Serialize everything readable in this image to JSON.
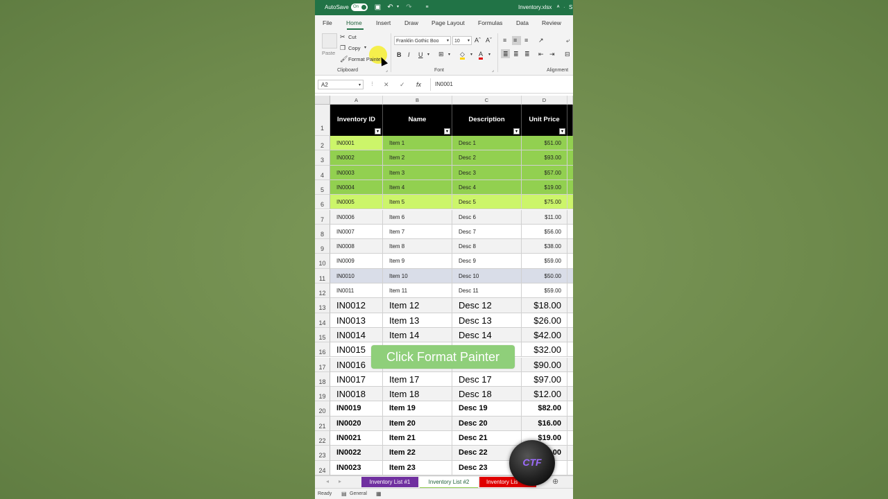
{
  "titlebar": {
    "autosave_label": "AutoSave",
    "autosave_state": "On",
    "file_name": "Inventory.xlsx",
    "trailing": "S"
  },
  "tabs": [
    "File",
    "Home",
    "Insert",
    "Draw",
    "Page Layout",
    "Formulas",
    "Data",
    "Review"
  ],
  "ribbon": {
    "clipboard": {
      "paste": "Paste",
      "cut": "Cut",
      "copy": "Copy",
      "format_painter": "Format Painter",
      "group": "Clipboard"
    },
    "font": {
      "name": "Franklin Gothic Boo",
      "size": "10",
      "group": "Font"
    },
    "alignment": {
      "group": "Alignment"
    }
  },
  "formula_bar": {
    "name_box": "A2",
    "value": "IN0001"
  },
  "grid": {
    "columns": [
      "A",
      "B",
      "C",
      "D"
    ],
    "headers": [
      "Inventory ID",
      "Name",
      "Description",
      "Unit Price"
    ],
    "rows": [
      {
        "n": "2",
        "id": "IN0001",
        "name": "Item 1",
        "desc": "Desc 1",
        "price": "$51.00"
      },
      {
        "n": "3",
        "id": "IN0002",
        "name": "Item 2",
        "desc": "Desc 2",
        "price": "$93.00"
      },
      {
        "n": "4",
        "id": "IN0003",
        "name": "Item 3",
        "desc": "Desc 3",
        "price": "$57.00"
      },
      {
        "n": "5",
        "id": "IN0004",
        "name": "Item 4",
        "desc": "Desc 4",
        "price": "$19.00"
      },
      {
        "n": "6",
        "id": "IN0005",
        "name": "Item 5",
        "desc": "Desc 5",
        "price": "$75.00"
      },
      {
        "n": "7",
        "id": "IN0006",
        "name": "Item 6",
        "desc": "Desc 6",
        "price": "$11.00"
      },
      {
        "n": "8",
        "id": "IN0007",
        "name": "Item 7",
        "desc": "Desc 7",
        "price": "$56.00"
      },
      {
        "n": "9",
        "id": "IN0008",
        "name": "Item 8",
        "desc": "Desc 8",
        "price": "$38.00"
      },
      {
        "n": "10",
        "id": "IN0009",
        "name": "Item 9",
        "desc": "Desc 9",
        "price": "$59.00"
      },
      {
        "n": "11",
        "id": "IN0010",
        "name": "Item 10",
        "desc": "Desc 10",
        "price": "$50.00"
      },
      {
        "n": "12",
        "id": "IN0011",
        "name": "Item 11",
        "desc": "Desc 11",
        "price": "$59.00"
      },
      {
        "n": "13",
        "id": "IN0012",
        "name": "Item 12",
        "desc": "Desc 12",
        "price": "$18.00"
      },
      {
        "n": "14",
        "id": "IN0013",
        "name": "Item 13",
        "desc": "Desc 13",
        "price": "$26.00"
      },
      {
        "n": "15",
        "id": "IN0014",
        "name": "Item 14",
        "desc": "Desc 14",
        "price": "$42.00"
      },
      {
        "n": "16",
        "id": "IN0015",
        "name": "",
        "desc": "",
        "price": "$32.00"
      },
      {
        "n": "17",
        "id": "IN0016",
        "name": "",
        "desc": "",
        "price": "$90.00"
      },
      {
        "n": "18",
        "id": "IN0017",
        "name": "Item 17",
        "desc": "Desc 17",
        "price": "$97.00"
      },
      {
        "n": "19",
        "id": "IN0018",
        "name": "Item 18",
        "desc": "Desc 18",
        "price": "$12.00"
      },
      {
        "n": "20",
        "id": "IN0019",
        "name": "Item 19",
        "desc": "Desc 19",
        "price": "$82.00"
      },
      {
        "n": "21",
        "id": "IN0020",
        "name": "Item 20",
        "desc": "Desc 20",
        "price": "$16.00"
      },
      {
        "n": "22",
        "id": "IN0021",
        "name": "Item 21",
        "desc": "Desc 21",
        "price": "$19.00"
      },
      {
        "n": "23",
        "id": "IN0022",
        "name": "Item 22",
        "desc": "Desc 22",
        "price": "00"
      },
      {
        "n": "24",
        "id": "IN0023",
        "name": "Item 23",
        "desc": "Desc 23",
        "price": ""
      }
    ]
  },
  "sheet_tabs": [
    {
      "label": "Inventory List #1",
      "color": "#7030a0"
    },
    {
      "label": "Inventory List #2",
      "color": "#92d050"
    },
    {
      "label": "Inventory Lis",
      "color": "#e00000"
    }
  ],
  "status": {
    "ready": "Ready",
    "format": "General"
  },
  "overlay": {
    "caption": "Click Format Painter",
    "logo": "CTF"
  }
}
